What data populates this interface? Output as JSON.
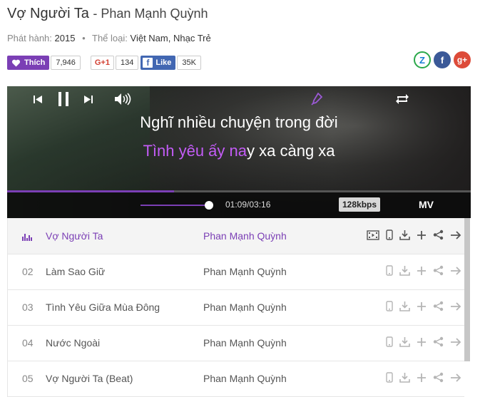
{
  "song": {
    "title": "Vợ Người Ta",
    "artist_sep": "- Phan Mạnh Quỳnh"
  },
  "meta": {
    "release_label": "Phát hành:",
    "release_year": "2015",
    "genre_label": "Thể loại:",
    "genre_value": "Việt Nam, Nhạc Trẻ"
  },
  "social": {
    "like_label": "Thích",
    "like_count": "7,946",
    "gplus_label": "G+1",
    "gplus_count": "134",
    "fb_label": "Like",
    "fb_count": "35K"
  },
  "lyrics": {
    "line1": "Nghĩ nhiều chuyện trong đời",
    "line2_done": "Tình yêu ấy na",
    "line2_rest": "y xa càng xa"
  },
  "player": {
    "time": "01:09/03:16",
    "bitrate": "128kbps",
    "mv_label": "MV",
    "progress": 0.36,
    "volume": 0.95
  },
  "tracks": [
    {
      "num": "",
      "name": "Vợ Người Ta",
      "artist": "Phan Mạnh Quỳnh"
    },
    {
      "num": "02",
      "name": "Làm Sao Giữ",
      "artist": "Phan Mạnh Quỳnh"
    },
    {
      "num": "03",
      "name": "Tình Yêu Giữa Mùa Đông",
      "artist": "Phan Mạnh Quỳnh"
    },
    {
      "num": "04",
      "name": "Nước Ngoài",
      "artist": "Phan Mạnh Quỳnh"
    },
    {
      "num": "05",
      "name": "Vợ Người Ta (Beat)",
      "artist": "Phan Mạnh Quỳnh"
    }
  ],
  "colors": {
    "accent": "#7b3fb5",
    "lyric_done": "#c35cf6"
  }
}
